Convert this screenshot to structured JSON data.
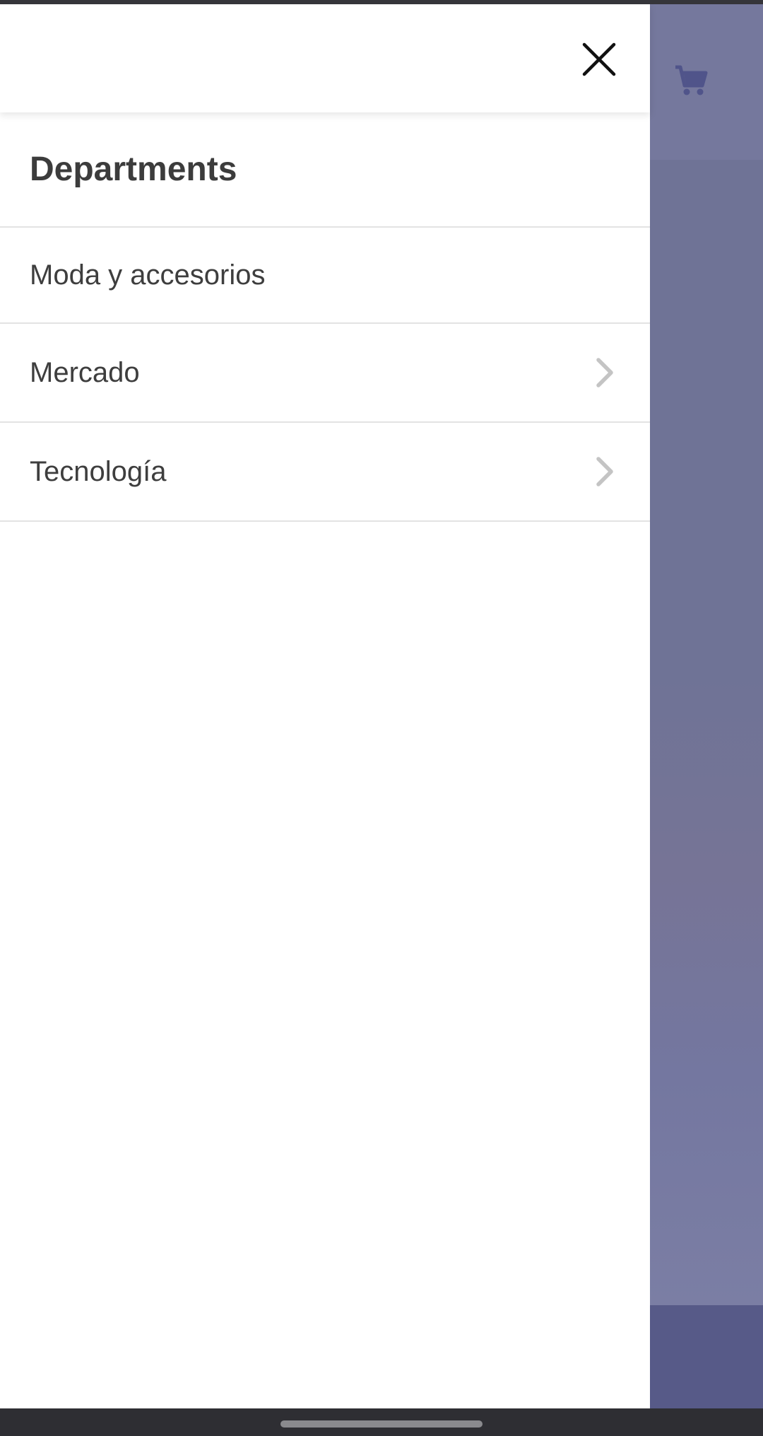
{
  "drawer": {
    "section_title": "Departments",
    "items": [
      {
        "label": "Moda y accesorios",
        "has_submenu": false
      },
      {
        "label": "Mercado",
        "has_submenu": true
      },
      {
        "label": "Tecnología",
        "has_submenu": true
      }
    ],
    "close_icon": "close-icon",
    "chevron_icon": "chevron-right-icon"
  },
  "background_app": {
    "cart_icon": "shopping-cart-icon",
    "scrim_color": "#727599",
    "bottom_color": "#575a88"
  },
  "system": {
    "nav_bar_color": "#2e2e33"
  }
}
